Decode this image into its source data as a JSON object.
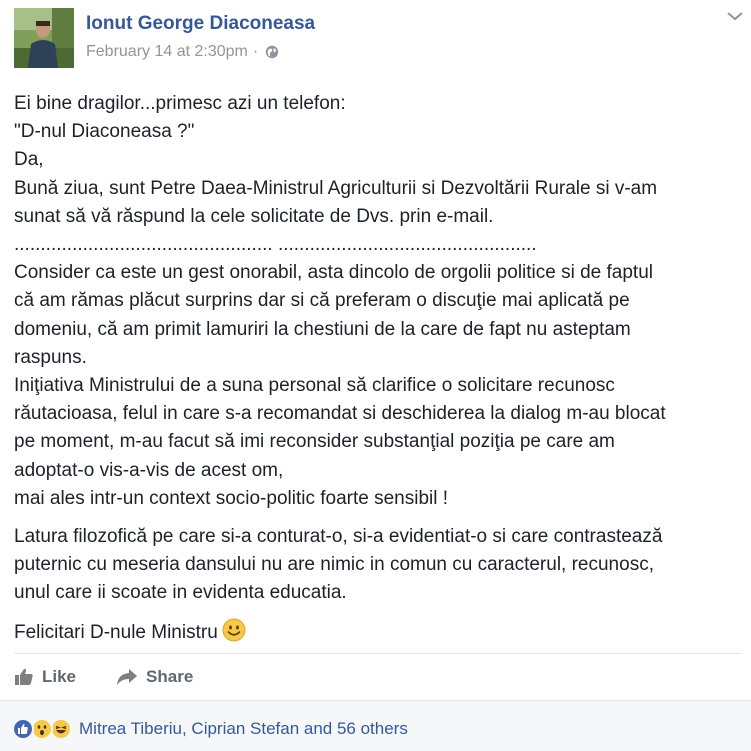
{
  "post": {
    "author": "Ionut George Diaconeasa",
    "timestamp": "February 14 at 2:30pm",
    "separator": "·",
    "privacy_icon": "globe-icon",
    "menu_icon": "chevron-down-icon",
    "lines_p1": [
      "Ei bine dragilor...primesc azi un telefon:",
      "\"D-nul Diaconeasa ?\"",
      "Da,",
      "Bună ziua, sunt Petre Daea-Ministrul Agriculturii si Dezvoltării Rurale si v-am",
      "sunat să vă răspund la cele solicitate de Dvs. prin e-mail.",
      "................................................. .................................................",
      "Consider ca este un gest onorabil, asta dincolo de orgolii politice si de faptul",
      "că am rămas plăcut surprins dar si că preferam o discuţie mai aplicată pe",
      "domeniu, că am primit lamuriri la chestiuni de la care de fapt nu asteptam",
      "raspuns.",
      "Iniţiativa Ministrului de a suna personal să clarifice o solicitare recunosc",
      "răutacioasa, felul in care s-a recomandat si deschiderea la dialog m-au blocat",
      "pe moment, m-au facut să imi reconsider substanţial poziţia pe care am",
      "adoptat-o vis-a-vis de acest om,",
      "mai ales intr-un context socio-politic foarte sensibil !"
    ],
    "lines_p2": [
      "Latura filozofică pe care si-a conturat-o, si-a evidentiat-o si care contrastează",
      "puternic cu meseria dansului nu are nimic in comun cu caracterul, recunosc,",
      "unul care ii scoate in evidenta educatia."
    ],
    "closing": "Felicitari D-nule Ministru",
    "closing_emoji": "smiley-icon"
  },
  "actions": {
    "like_label": "Like",
    "share_label": "Share"
  },
  "reactions": {
    "icons": [
      "like-reaction-icon",
      "wow-reaction-icon",
      "haha-reaction-icon"
    ],
    "summary": "Mitrea Tiberiu, Ciprian Stefan and 56 others"
  },
  "colors": {
    "link": "#365899",
    "meta": "#90949c",
    "text": "#1d2129",
    "like_blue": "#4267b2",
    "emoji_yellow": "#f7c948"
  }
}
